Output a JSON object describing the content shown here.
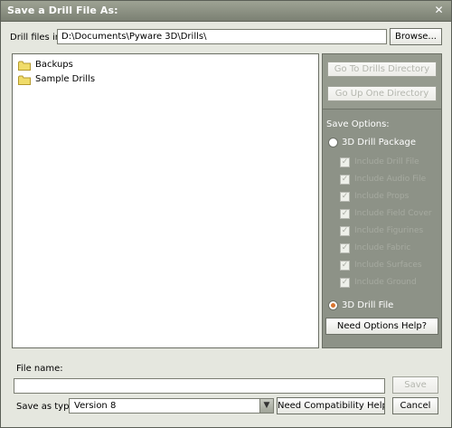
{
  "window": {
    "title": "Save a Drill File As:",
    "close_glyph": "✕"
  },
  "location": {
    "label": "Drill files in:",
    "path": "D:\\Documents\\Pyware 3D\\Drills\\",
    "browse_label": "Browse..."
  },
  "files": [
    {
      "name": "Backups",
      "icon": "folder-icon"
    },
    {
      "name": "Sample Drills",
      "icon": "folder-icon"
    }
  ],
  "nav_buttons": {
    "goto_drills": "Go To Drills Directory",
    "up_one": "Go Up One Directory"
  },
  "save_options": {
    "title": "Save Options:",
    "package_label": "3D Drill Package",
    "package_selected": false,
    "include_items": [
      "Include Drill File",
      "Include Audio File",
      "Include Props",
      "Include Field Cover",
      "Include Figurines",
      "Include Fabric",
      "Include Surfaces",
      "Include Ground"
    ],
    "drill_file_label": "3D Drill File",
    "drill_file_selected": true,
    "help_label": "Need Options Help?"
  },
  "file_name": {
    "label": "File name:",
    "value": ""
  },
  "save_type": {
    "label": "Save as type:",
    "value": "Version 8",
    "compat_help_label": "Need Compatibility Help?"
  },
  "actions": {
    "save_label": "Save",
    "cancel_label": "Cancel"
  },
  "colors": {
    "accent": "#d9742f",
    "pane": "#8d9287",
    "titlebar": "#7b8073"
  }
}
